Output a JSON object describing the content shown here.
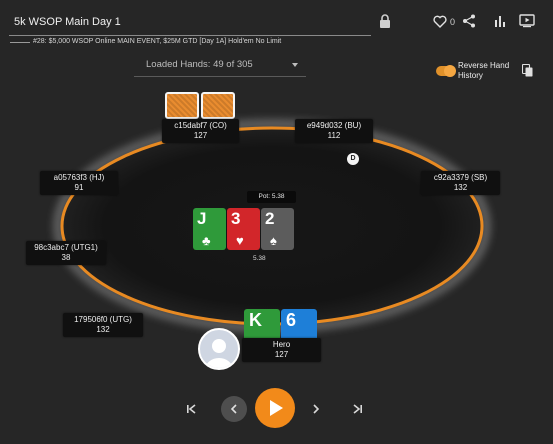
{
  "header": {
    "title": "5k WSOP Main Day 1",
    "subtitle": "#28: $5,000 WSOP Online MAIN EVENT, $25M GTD [Day 1A] Hold'em No Limit",
    "likes": "0"
  },
  "icons": {
    "lock": "lock-icon",
    "heart": "heart-icon",
    "share": "share-icon",
    "stats": "bar-chart-icon",
    "video": "video-icon",
    "copy": "copy-icon"
  },
  "loaded_hands": "Loaded Hands: 49 of 305",
  "reverse_history": {
    "line1": "Reverse Hand",
    "line2": "History"
  },
  "seats": {
    "co": {
      "name": "c15dabf7 (CO)",
      "stack": "127"
    },
    "bu": {
      "name": "e949d032 (BU)",
      "stack": "112"
    },
    "sb": {
      "name": "c92a3379 (SB)",
      "stack": "132"
    },
    "hj": {
      "name": "a05763f3 (HJ)",
      "stack": "91"
    },
    "utg1": {
      "name": "98c3abc7 (UTG1)",
      "stack": "38"
    },
    "utg": {
      "name": "179506f0 (UTG)",
      "stack": "132"
    },
    "hero": {
      "name": "Hero",
      "stack": "127"
    }
  },
  "dealer_button": "D",
  "pot": "Pot: 5.38",
  "bet_amount": "5.38",
  "board": [
    {
      "rank": "J",
      "suit": "♣",
      "color": "#2f9a3a"
    },
    {
      "rank": "3",
      "suit": "♥",
      "color": "#d2262a"
    },
    {
      "rank": "2",
      "suit": "♠",
      "color": "#5c5c5c"
    }
  ],
  "hero_cards": [
    {
      "rank": "K",
      "suit": "♣",
      "color": "#2f9a3a"
    },
    {
      "rank": "6",
      "suit": "♦",
      "color": "#1e7fd8"
    }
  ],
  "colors": {
    "accent": "#f28a1a",
    "table_rim": "#e88a22",
    "background": "#262626"
  },
  "controls": [
    "first-hand",
    "previous-action",
    "play",
    "next-action",
    "last-hand"
  ]
}
